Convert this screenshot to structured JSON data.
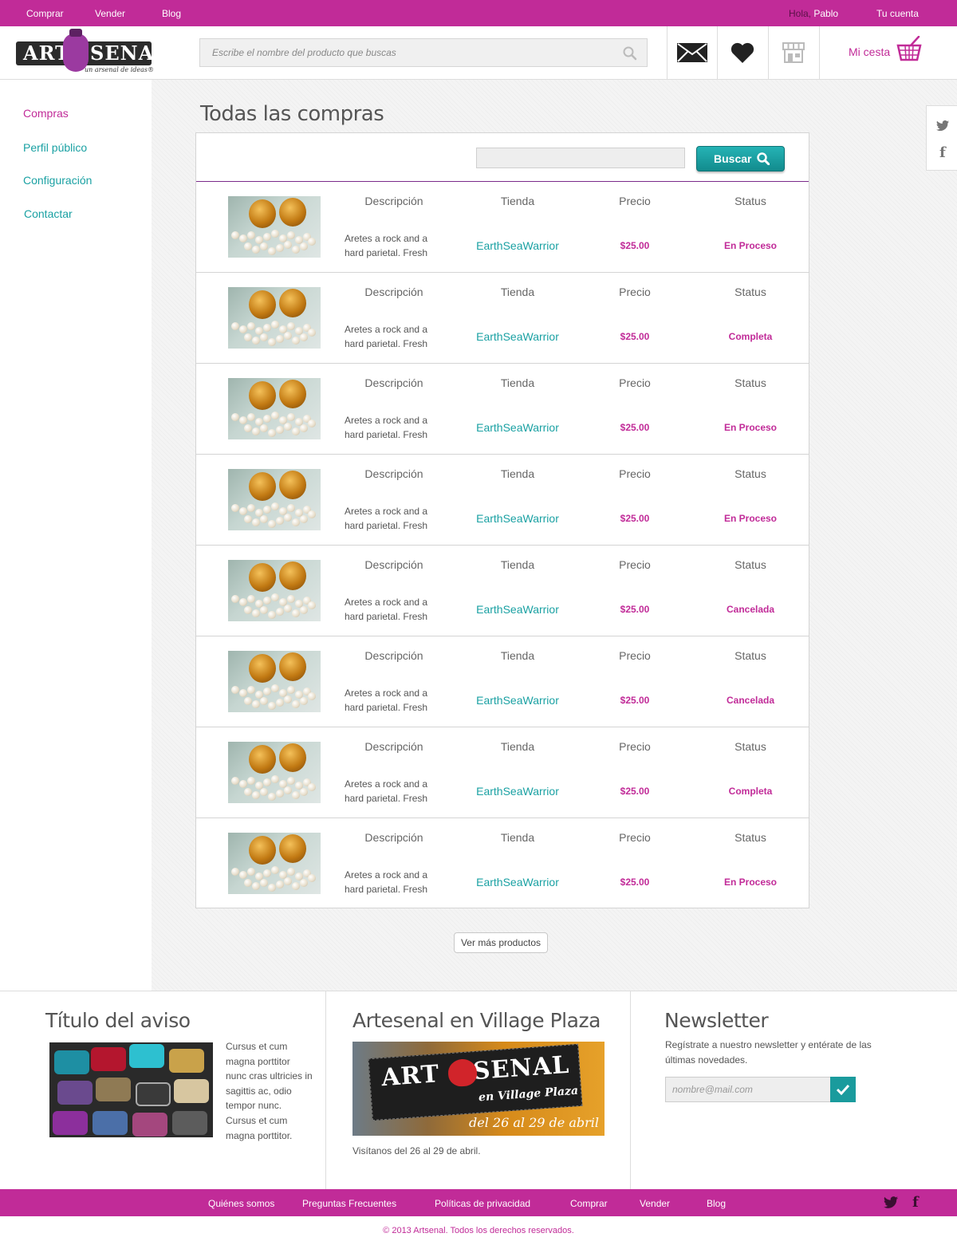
{
  "topbar": {
    "links": [
      "Comprar",
      "Vender",
      "Blog"
    ],
    "greeting_hola": "Hola,",
    "greeting_name": "Pablo",
    "account": "Tu cuenta"
  },
  "brand": {
    "art": "ART",
    "senal": "SENAL",
    "tagline": "un arsenal de ideas®",
    "accent": "#c12b98",
    "teal": "#1aa1a3"
  },
  "header": {
    "search_placeholder": "Escribe el nombre del producto que buscas",
    "icons": [
      "mail-icon",
      "heart-icon",
      "store-icon"
    ],
    "cart_label": "Mi cesta"
  },
  "sidebar": {
    "items": [
      {
        "label": "Compras"
      },
      {
        "label": "Perfil público"
      },
      {
        "label": "Configuración"
      },
      {
        "label": "Contactar"
      }
    ]
  },
  "main": {
    "title": "Todas las compras",
    "search_button": "Buscar",
    "columns": {
      "description": "Descripción",
      "store": "Tienda",
      "price": "Precio",
      "status": "Status"
    },
    "orders": [
      {
        "desc": "Aretes a rock and a hard parietal. Fresh",
        "store": "EarthSeaWarrior",
        "price": "$25.00",
        "status": "En Proceso"
      },
      {
        "desc": "Aretes a rock and a hard parietal. Fresh",
        "store": "EarthSeaWarrior",
        "price": "$25.00",
        "status": "Completa"
      },
      {
        "desc": "Aretes a rock and a hard parietal. Fresh",
        "store": "EarthSeaWarrior",
        "price": "$25.00",
        "status": "En Proceso"
      },
      {
        "desc": "Aretes a rock and a hard parietal. Fresh",
        "store": "EarthSeaWarrior",
        "price": "$25.00",
        "status": "En Proceso"
      },
      {
        "desc": "Aretes a rock and a hard parietal. Fresh",
        "store": "EarthSeaWarrior",
        "price": "$25.00",
        "status": "Cancelada"
      },
      {
        "desc": "Aretes a rock and a hard parietal. Fresh",
        "store": "EarthSeaWarrior",
        "price": "$25.00",
        "status": "Cancelada"
      },
      {
        "desc": "Aretes a rock and a hard parietal. Fresh",
        "store": "EarthSeaWarrior",
        "price": "$25.00",
        "status": "Completa"
      },
      {
        "desc": "Aretes a rock and a hard parietal. Fresh",
        "store": "EarthSeaWarrior",
        "price": "$25.00",
        "status": "En Proceso"
      }
    ],
    "more_button": "Ver más productos"
  },
  "footer": {
    "aviso_title": "Título del aviso",
    "aviso_text": "Cursus et cum magna porttitor nunc cras ultricies in sagittis ac, odio tempor nunc. Cursus et cum magna porttitor.",
    "plaza_title": "Artesenal en Village Plaza",
    "plaza_banner_art": "ART",
    "plaza_banner_senal": "SENAL",
    "plaza_banner_sub": "en Village Plaza",
    "plaza_banner_dates": "del 26 al 29 de abril",
    "plaza_caption": "Visítanos del 26 al 29 de abril.",
    "news_title": "Newsletter",
    "news_text": "Regístrate a nuestro newsletter y entérate de las últimas novedades.",
    "news_placeholder": "nombre@mail.com"
  },
  "bottombar": {
    "links": [
      "Quiénes somos",
      "Preguntas Frecuentes",
      "Políticas de privacidad",
      "Comprar",
      "Vender",
      "Blog"
    ],
    "copyright": "© 2013 Artsenal. Todos los derechos reservados."
  }
}
